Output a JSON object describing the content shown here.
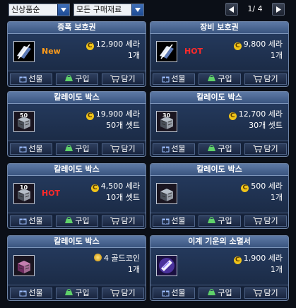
{
  "filters": {
    "sort": {
      "value": "신상품순"
    },
    "category": {
      "value": "모든 구매재료"
    }
  },
  "pagination": {
    "text": "1/ 4"
  },
  "cards": [
    {
      "title": "증폭 보호권",
      "badge": "New",
      "badge_type": "new",
      "currency_icon": "cera-coin-icon",
      "price": "12,900 세라",
      "quantity": "1개",
      "item_icon": "amplify-protection-ticket-icon"
    },
    {
      "title": "장비 보호권",
      "badge": "HOT",
      "badge_type": "hot",
      "currency_icon": "cera-coin-icon",
      "price": "9,800 세라",
      "quantity": "1개",
      "item_icon": "equipment-protection-ticket-icon"
    },
    {
      "title": "칼레이도 박스",
      "badge": "",
      "badge_type": "",
      "currency_icon": "cera-coin-icon",
      "price": "19,900 세라",
      "quantity": "50개 셋트",
      "item_icon": "kaleido-box-50-icon",
      "icon_number": "50"
    },
    {
      "title": "칼레이도 박스",
      "badge": "",
      "badge_type": "",
      "currency_icon": "cera-coin-icon",
      "price": "12,700 세라",
      "quantity": "30개 셋트",
      "item_icon": "kaleido-box-30-icon",
      "icon_number": "30"
    },
    {
      "title": "칼레이도 박스",
      "badge": "HOT",
      "badge_type": "hot",
      "currency_icon": "cera-coin-icon",
      "price": "4,500 세라",
      "quantity": "10개 셋트",
      "item_icon": "kaleido-box-10-icon",
      "icon_number": "10"
    },
    {
      "title": "칼레이도 박스",
      "badge": "",
      "badge_type": "",
      "currency_icon": "cera-coin-icon",
      "price": "500 세라",
      "quantity": "1개",
      "item_icon": "kaleido-box-icon",
      "icon_number": ""
    },
    {
      "title": "칼레이도 박스",
      "badge": "",
      "badge_type": "",
      "currency_icon": "gold-coin-icon",
      "price": "4 골드코인",
      "quantity": "1개",
      "item_icon": "kaleido-box-pink-icon",
      "icon_number": ""
    },
    {
      "title": "이계 기운의 소멸서",
      "badge": "",
      "badge_type": "",
      "currency_icon": "cera-coin-icon",
      "price": "1,900 세라",
      "quantity": "1개",
      "item_icon": "otherworld-extinction-scroll-icon"
    }
  ],
  "actions": {
    "gift": "선물",
    "buy": "구입",
    "cart": "담기"
  },
  "colors": {
    "background": "#0b0f17",
    "card": "#223554",
    "card_title": "#4a6690",
    "badge_new": "#ff9c1a",
    "badge_hot": "#ff2a2a",
    "cera_coin": "#f0c419"
  }
}
